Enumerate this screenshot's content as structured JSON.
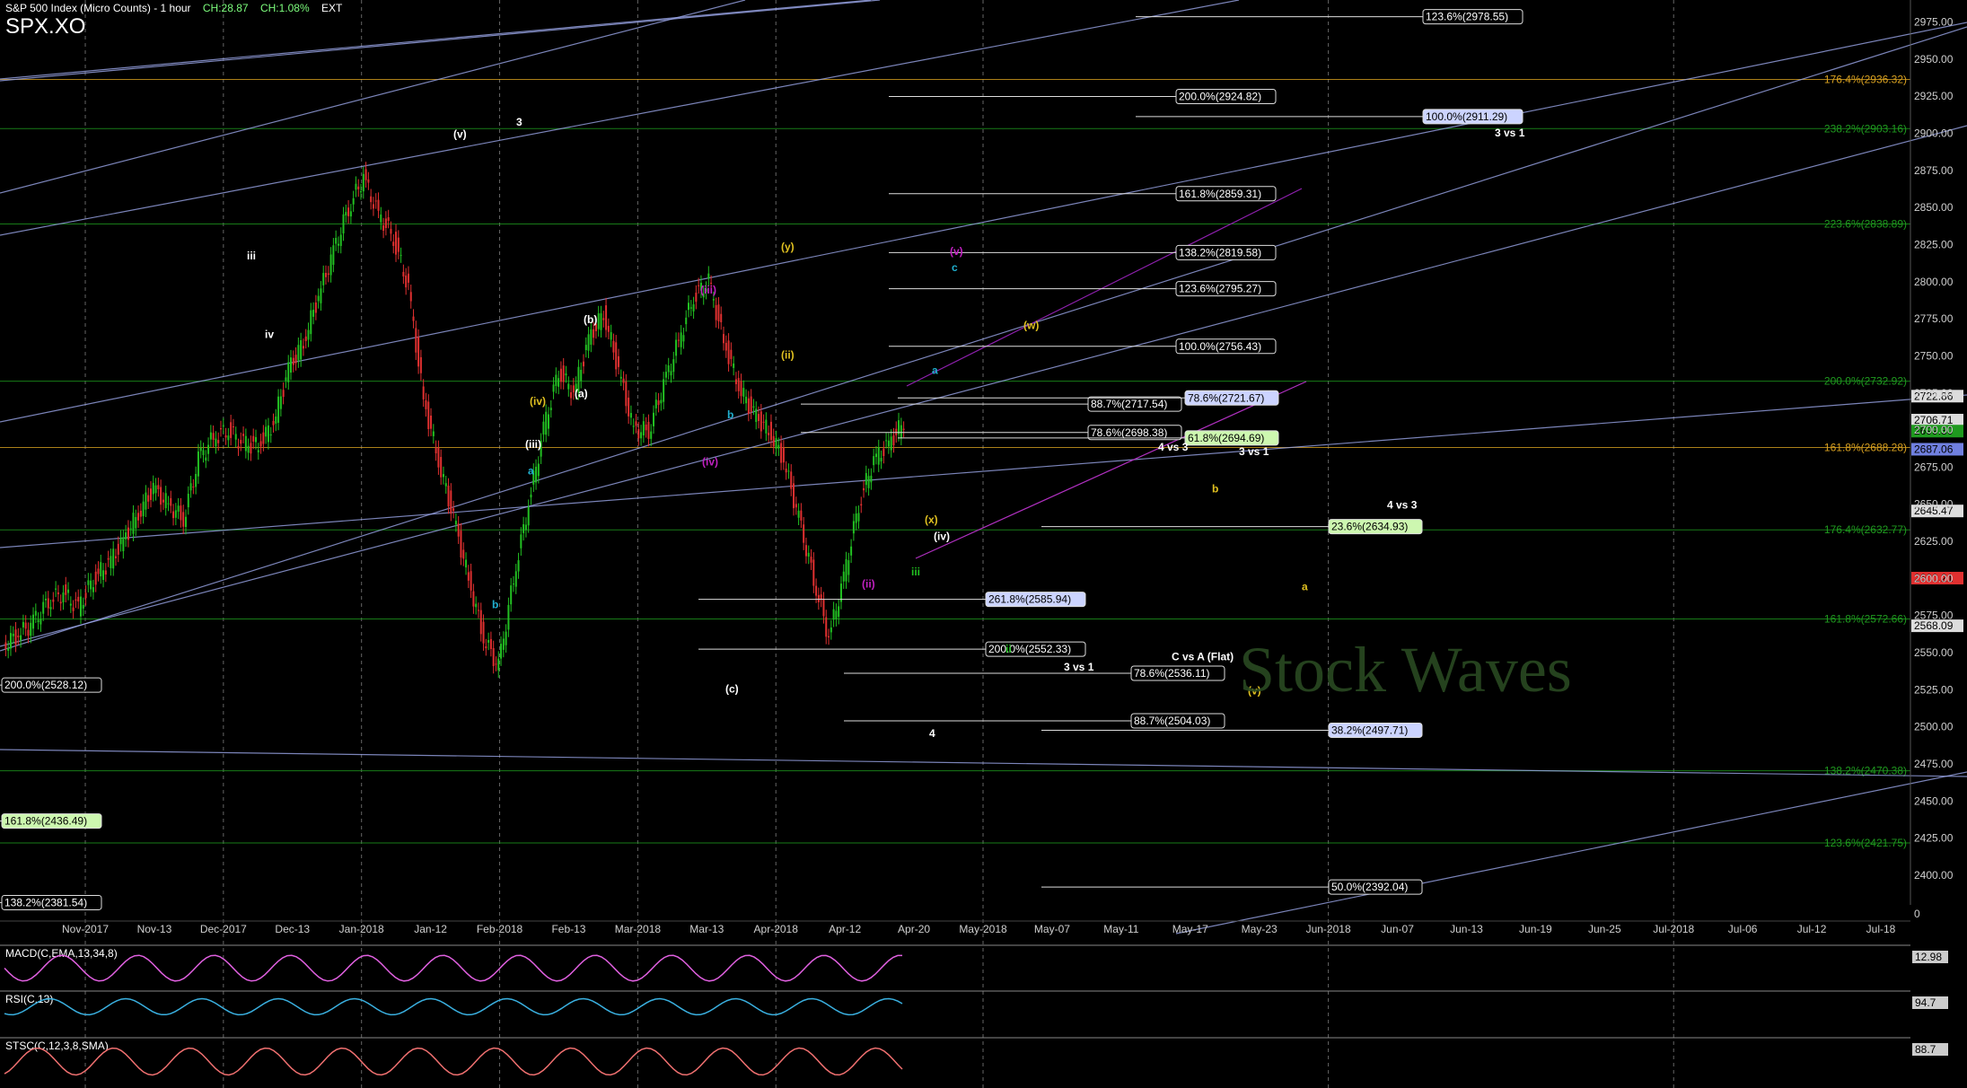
{
  "header": {
    "title": "S&P 500 Index (Micro Counts) - 1 hour",
    "change_points": "CH:28.87",
    "change_pct": "CH:1.08%",
    "session": "EXT",
    "symbol": "SPX.XO"
  },
  "colors": {
    "background": "#000000",
    "candle_up": "#22c022",
    "candle_down": "#e03030",
    "trend_line": "#9aa6e8",
    "fib_orange": "#d8a020",
    "fib_green": "#1f9a1f",
    "grid": "#2a2a2a",
    "macd": "#e060e0",
    "rsi": "#3ab0e0",
    "stoch": "#f07070"
  },
  "chart_data": {
    "type": "candlestick",
    "price_axis": {
      "range": [
        2380,
        2985
      ],
      "ticks": [
        "2975.00",
        "2950.00",
        "2925.00",
        "2900.00",
        "2875.00",
        "2850.00",
        "2825.00",
        "2800.00",
        "2775.00",
        "2750.00",
        "2725.00",
        "2700.00",
        "2675.00",
        "2650.00",
        "2625.00",
        "2600.00",
        "2575.00",
        "2550.00",
        "2525.00",
        "2500.00",
        "2475.00",
        "2450.00",
        "2425.00",
        "2400.00"
      ],
      "zero_label": "0"
    },
    "time_axis": {
      "labels": [
        "Nov-2017",
        "Nov-13",
        "Dec-2017",
        "Dec-13",
        "Jan-2018",
        "Jan-12",
        "Feb-2018",
        "Feb-13",
        "Mar-2018",
        "Mar-13",
        "Apr-2018",
        "Apr-12",
        "Apr-20",
        "May-2018",
        "May-07",
        "May-11",
        "May-17",
        "May-23",
        "Jun-2018",
        "Jun-07",
        "Jun-13",
        "Jun-19",
        "Jun-25",
        "Jul-2018",
        "Jul-06",
        "Jul-12",
        "Jul-18"
      ],
      "price_bar_count": 112
    },
    "price_path": [
      2555,
      2562,
      2570,
      2585,
      2590,
      2580,
      2600,
      2610,
      2625,
      2645,
      2660,
      2650,
      2640,
      2680,
      2695,
      2700,
      2690,
      2690,
      2705,
      2740,
      2760,
      2790,
      2820,
      2850,
      2870,
      2845,
      2830,
      2795,
      2720,
      2680,
      2640,
      2600,
      2560,
      2540,
      2600,
      2650,
      2700,
      2740,
      2725,
      2760,
      2780,
      2740,
      2700,
      2700,
      2730,
      2760,
      2790,
      2800,
      2760,
      2730,
      2710,
      2700,
      2680,
      2640,
      2600,
      2560,
      2600,
      2650,
      2680,
      2690,
      2706
    ],
    "right_price_labels": [
      {
        "text": "2722.86",
        "color": "#dddddd"
      },
      {
        "text": "2706.71",
        "color": "#dddddd"
      },
      {
        "text": "2699.30",
        "color": "#1f9a1f"
      },
      {
        "text": "2687.06",
        "color": "#7080e0"
      },
      {
        "text": "2645.47",
        "color": "#dddddd"
      },
      {
        "text": "2600.21",
        "color": "#e03030"
      },
      {
        "text": "2568.09",
        "color": "#dddddd"
      }
    ],
    "fib_box_labels": [
      {
        "text": "123.6%(2978.55)",
        "price": 2978.55,
        "style": "box"
      },
      {
        "text": "200.0%(2924.82)",
        "price": 2924.82,
        "style": "box"
      },
      {
        "text": "100.0%(2911.29)",
        "price": 2911.29,
        "style": "hl"
      },
      {
        "text": "161.8%(2859.31)",
        "price": 2859.31,
        "style": "box"
      },
      {
        "text": "138.2%(2819.58)",
        "price": 2819.58,
        "style": "box"
      },
      {
        "text": "123.6%(2795.27)",
        "price": 2795.27,
        "style": "box"
      },
      {
        "text": "100.0%(2756.43)",
        "price": 2756.43,
        "style": "box"
      },
      {
        "text": "88.7%(2717.54)",
        "price": 2717.54,
        "style": "box"
      },
      {
        "text": "78.6%(2721.67)",
        "price": 2721.67,
        "style": "hl"
      },
      {
        "text": "78.6%(2698.38)",
        "price": 2698.38,
        "style": "box"
      },
      {
        "text": "61.8%(2694.69)",
        "price": 2694.69,
        "style": "hlg"
      },
      {
        "text": "23.6%(2634.93)",
        "price": 2634.93,
        "style": "hlg"
      },
      {
        "text": "261.8%(2585.94)",
        "price": 2585.94,
        "style": "hl"
      },
      {
        "text": "200.0%(2552.33)",
        "price": 2552.33,
        "style": "box"
      },
      {
        "text": "78.6%(2536.11)",
        "price": 2536.11,
        "style": "box"
      },
      {
        "text": "88.7%(2504.03)",
        "price": 2504.03,
        "style": "box"
      },
      {
        "text": "38.2%(2497.71)",
        "price": 2497.71,
        "style": "hl"
      },
      {
        "text": "50.0%(2392.04)",
        "price": 2392.04,
        "style": "box"
      },
      {
        "text": "200.0%(2528.12)",
        "price": 2528.12,
        "style": "box"
      },
      {
        "text": "161.8%(2436.49)",
        "price": 2436.49,
        "style": "hlg"
      },
      {
        "text": "138.2%(2381.54)",
        "price": 2381.54,
        "style": "box"
      }
    ],
    "fib_levels": [
      {
        "text": "176.4%(2936.32)",
        "price": 2936.32,
        "color": "orange"
      },
      {
        "text": "238.2%(2903.16)",
        "price": 2903.16,
        "color": "green"
      },
      {
        "text": "223.6%(2838.89)",
        "price": 2838.89,
        "color": "green"
      },
      {
        "text": "200.0%(2732.92)",
        "price": 2732.92,
        "color": "green"
      },
      {
        "text": "161.8%(2688.28)",
        "price": 2688.28,
        "color": "orange"
      },
      {
        "text": "176.4%(2632.77)",
        "price": 2632.77,
        "color": "green"
      },
      {
        "text": "161.8%(2572.66)",
        "price": 2572.66,
        "color": "green"
      },
      {
        "text": "138.2%(2470.38)",
        "price": 2470.38,
        "color": "green"
      },
      {
        "text": "123.6%(2421.75)",
        "price": 2421.75,
        "color": "green"
      }
    ],
    "annotations": [
      {
        "text": "3 vs 1",
        "price": 2898,
        "color": "#ffffff"
      },
      {
        "text": "4 vs 3",
        "price": 2686,
        "color": "#ffffff"
      },
      {
        "text": "3 vs 1",
        "price": 2683,
        "color": "#ffffff"
      },
      {
        "text": "4 vs 3",
        "price": 2647,
        "color": "#ffffff"
      },
      {
        "text": "C vs A (Flat)",
        "price": 2545,
        "color": "#ffffff"
      },
      {
        "text": "3 vs 1",
        "price": 2538,
        "color": "#ffffff"
      },
      {
        "text": "4",
        "price": 2493,
        "color": "#ffffff"
      },
      {
        "text": "3",
        "price": 2905,
        "color": "#ffffff"
      },
      {
        "text": "(v)",
        "price": 2897,
        "color": "#ffffff"
      },
      {
        "text": "iii",
        "price": 2815,
        "color": "#ffffff"
      },
      {
        "text": "iv",
        "price": 2762,
        "color": "#ffffff"
      },
      {
        "text": "(iii)",
        "price": 2688,
        "color": "#ffffff"
      },
      {
        "text": "(iv)",
        "price": 2626,
        "color": "#ffffff"
      },
      {
        "text": "(b)",
        "price": 2772,
        "color": "#ffffff"
      },
      {
        "text": "(a)",
        "price": 2722,
        "color": "#ffffff"
      },
      {
        "text": "(c)",
        "price": 2523,
        "color": "#ffffff"
      },
      {
        "text": "(y)",
        "price": 2821,
        "color": "#e0c020"
      },
      {
        "text": "(w)",
        "price": 2768,
        "color": "#e0c020"
      },
      {
        "text": "(ii)",
        "price": 2748,
        "color": "#e0c020"
      },
      {
        "text": "(iv)",
        "price": 2717,
        "color": "#e0c020"
      },
      {
        "text": "(x)",
        "price": 2637,
        "color": "#e0c020"
      },
      {
        "text": "b",
        "price": 2658,
        "color": "#e0c020"
      },
      {
        "text": "a",
        "price": 2592,
        "color": "#e0c020"
      },
      {
        "text": "(v)",
        "price": 2522,
        "color": "#e0c020"
      },
      {
        "text": "(iii)",
        "price": 2792,
        "color": "#c020c0"
      },
      {
        "text": "(iv)",
        "price": 2676,
        "color": "#c020c0"
      },
      {
        "text": "(ii)",
        "price": 2594,
        "color": "#c020c0"
      },
      {
        "text": "(v)",
        "price": 2818,
        "color": "#c020c0"
      },
      {
        "text": "a",
        "price": 2738,
        "color": "#20b0d0"
      },
      {
        "text": "b",
        "price": 2708,
        "color": "#20b0d0"
      },
      {
        "text": "a",
        "price": 2670,
        "color": "#20b0d0"
      },
      {
        "text": "b",
        "price": 2580,
        "color": "#20b0d0"
      },
      {
        "text": "c",
        "price": 2807,
        "color": "#20b0d0"
      },
      {
        "text": "iii",
        "price": 2602,
        "color": "#20c020"
      },
      {
        "text": "ii",
        "price": 2550,
        "color": "#20c020"
      }
    ],
    "indicators": [
      {
        "name": "MACD(C,EMA,13,34,8)",
        "value": "12.98"
      },
      {
        "name": "RSI(C,13)",
        "value": "94.7"
      },
      {
        "name": "STSC(C,12,3,8,SMA)",
        "value": "88.7"
      }
    ],
    "watermark": "Stock Waves"
  }
}
